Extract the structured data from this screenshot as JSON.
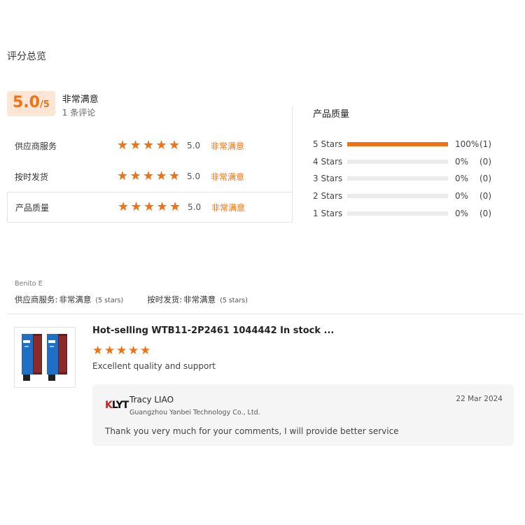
{
  "section_title": "评分总览",
  "summary": {
    "score": "5.0",
    "score_denominator": "/5",
    "label": "非常满意",
    "review_count": "1 条评论"
  },
  "ratings": [
    {
      "name": "供应商服务",
      "value": "5.0",
      "desc": "非常满意",
      "stars": 5
    },
    {
      "name": "按时发货",
      "value": "5.0",
      "desc": "非常满意",
      "stars": 5
    },
    {
      "name": "产品质量",
      "value": "5.0",
      "desc": "非常满意",
      "stars": 5
    }
  ],
  "distribution": {
    "title": "产品质量",
    "rows": [
      {
        "label": "5  Stars",
        "fraction": 1.0,
        "percent": "100%",
        "count": "(1)"
      },
      {
        "label": "4  Stars",
        "fraction": 0.0,
        "percent": "0%",
        "count": "(0)"
      },
      {
        "label": "3  Stars",
        "fraction": 0.0,
        "percent": "0%",
        "count": "(0)"
      },
      {
        "label": "2  Stars",
        "fraction": 0.0,
        "percent": "0%",
        "count": "(0)"
      },
      {
        "label": "1  Stars",
        "fraction": 0.0,
        "percent": "0%",
        "count": "(0)"
      }
    ]
  },
  "review": {
    "reviewer": "Benito E",
    "meta": [
      {
        "label": "供应商服务:",
        "value": "非常满意",
        "stars": "(5 stars)"
      },
      {
        "label": "按时发货:",
        "value": "非常满意",
        "stars": "(5 stars)"
      }
    ],
    "product_title": "Hot-selling WTB11-2P2461 1044442 In stock ...",
    "rating": 5,
    "text": "Excellent quality and support",
    "reply": {
      "logo": "KLYT",
      "name": "Tracy LIAO",
      "company": "Guangzhou Yanbei Technology Co., Ltd.",
      "date": "22 Mar 2024",
      "text": "Thank you very much for your comments, I will provide better service"
    }
  },
  "colors": {
    "accent": "#f07215",
    "score_bg": "#fde6d6"
  }
}
